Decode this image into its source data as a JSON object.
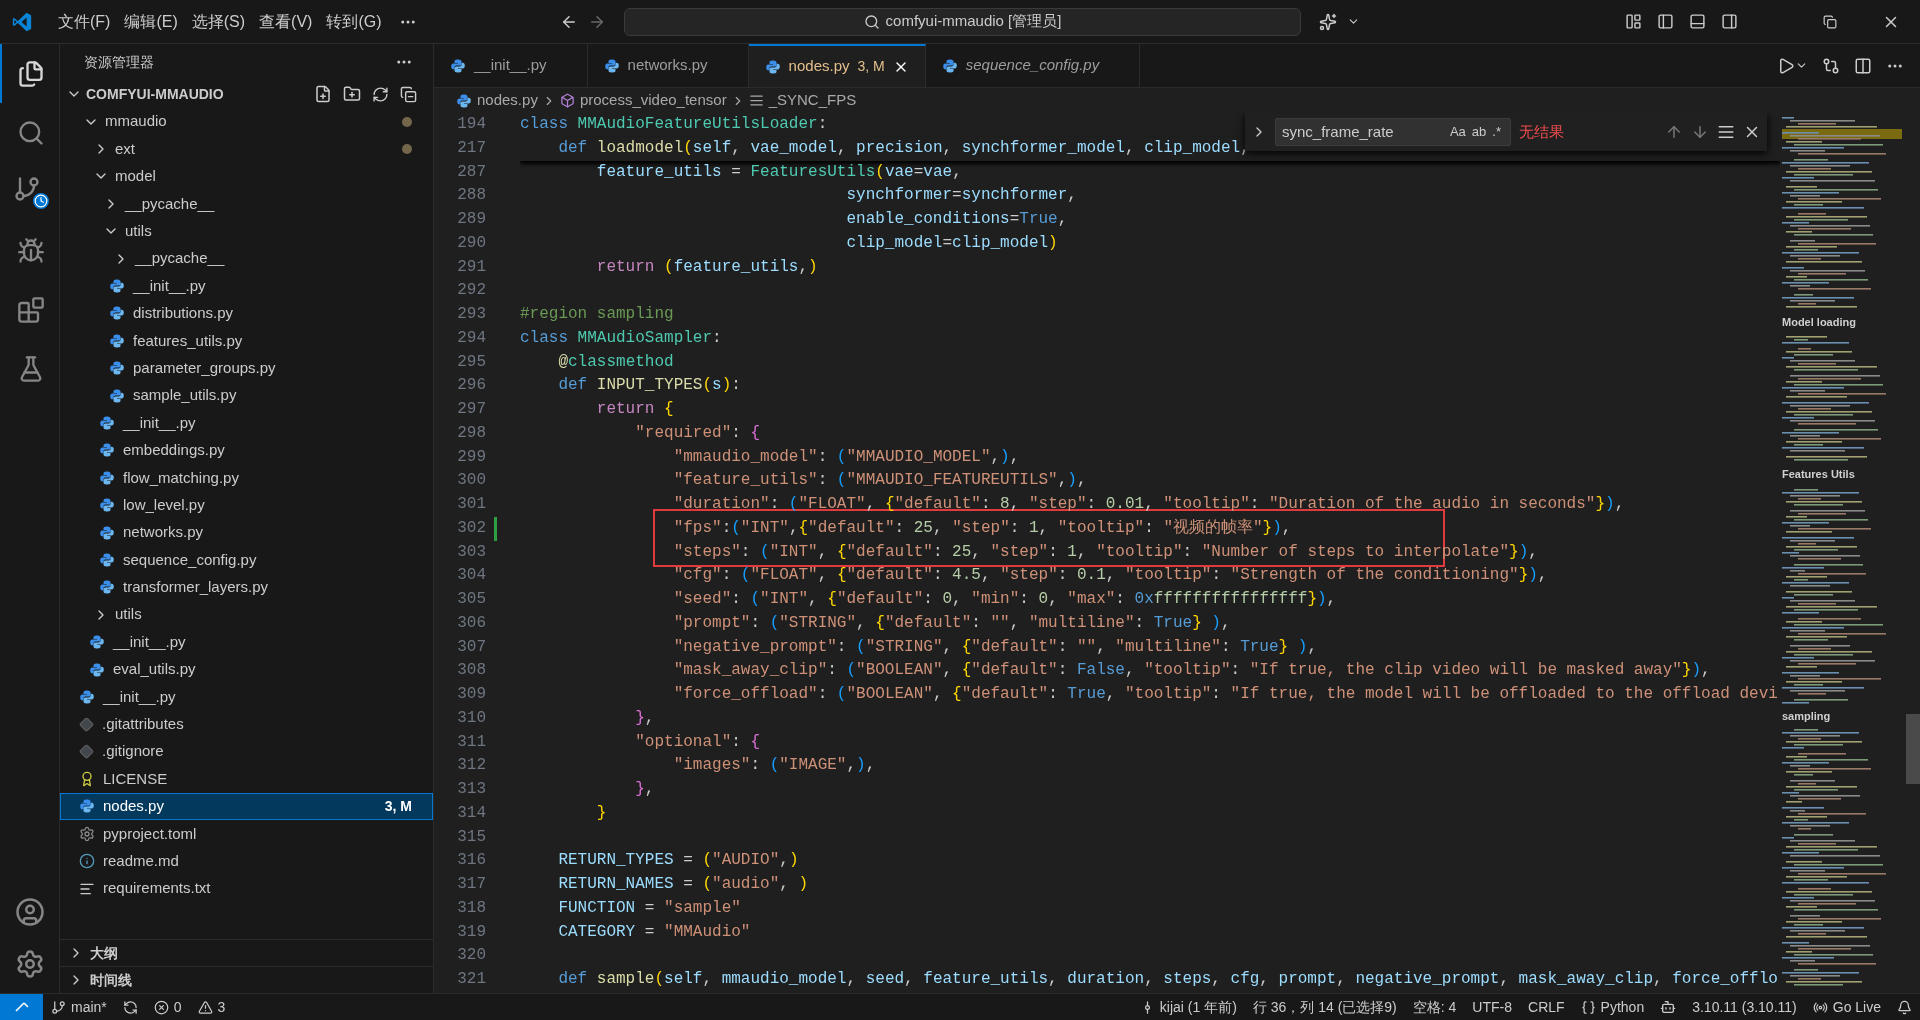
{
  "title_bar": {
    "menus": [
      "文件(F)",
      "编辑(E)",
      "选择(S)",
      "查看(V)",
      "转到(G)"
    ],
    "command_center": "comfyui-mmaudio [管理员]"
  },
  "activity_bar": [
    {
      "kind": "explorer",
      "selected": true
    },
    {
      "kind": "search",
      "selected": false
    },
    {
      "kind": "source-control",
      "selected": false
    },
    {
      "kind": "debug",
      "selected": false
    },
    {
      "kind": "extensions",
      "selected": false
    },
    {
      "kind": "testing",
      "selected": false
    }
  ],
  "sidebar": {
    "title": "资源管理器",
    "root": "COMFYUI-MMAUDIO",
    "tree": [
      {
        "label": "mmaudio",
        "kind": "folder",
        "expanded": true,
        "selected": false,
        "modified": true,
        "children": [
          {
            "label": "ext",
            "kind": "folder",
            "expanded": false,
            "selected": false,
            "modified": true
          },
          {
            "label": "model",
            "kind": "folder",
            "expanded": true,
            "selected": false,
            "modified": false,
            "children": [
              {
                "label": "__pycache__",
                "kind": "folder",
                "expanded": false,
                "selected": false,
                "modified": false
              },
              {
                "label": "utils",
                "kind": "folder",
                "expanded": true,
                "selected": false,
                "modified": false,
                "children": [
                  {
                    "label": "__pycache__",
                    "kind": "folder",
                    "expanded": false,
                    "selected": false,
                    "modified": false
                  },
                  {
                    "label": "__init__.py",
                    "kind": "python",
                    "selected": false,
                    "modified": false
                  },
                  {
                    "label": "distributions.py",
                    "kind": "python",
                    "selected": false,
                    "modified": false
                  },
                  {
                    "label": "features_utils.py",
                    "kind": "python",
                    "selected": false,
                    "modified": false
                  },
                  {
                    "label": "parameter_groups.py",
                    "kind": "python",
                    "selected": false,
                    "modified": false
                  },
                  {
                    "label": "sample_utils.py",
                    "kind": "python",
                    "selected": false,
                    "modified": false
                  }
                ]
              },
              {
                "label": "__init__.py",
                "kind": "python",
                "selected": false,
                "modified": false
              },
              {
                "label": "embeddings.py",
                "kind": "python",
                "selected": false,
                "modified": false
              },
              {
                "label": "flow_matching.py",
                "kind": "python",
                "selected": false,
                "modified": false
              },
              {
                "label": "low_level.py",
                "kind": "python",
                "selected": false,
                "modified": false
              },
              {
                "label": "networks.py",
                "kind": "python",
                "selected": false,
                "modified": false
              },
              {
                "label": "sequence_config.py",
                "kind": "python",
                "selected": false,
                "modified": false
              },
              {
                "label": "transformer_layers.py",
                "kind": "python",
                "selected": false,
                "modified": false
              }
            ]
          },
          {
            "label": "utils",
            "kind": "folder",
            "expanded": false,
            "selected": false,
            "modified": false
          },
          {
            "label": "__init__.py",
            "kind": "python",
            "selected": false,
            "modified": false
          },
          {
            "label": "eval_utils.py",
            "kind": "python",
            "selected": false,
            "modified": false
          }
        ]
      },
      {
        "label": "__init__.py",
        "kind": "python",
        "selected": false,
        "modified": false
      },
      {
        "label": ".gitattributes",
        "kind": "git",
        "selected": false,
        "modified": false
      },
      {
        "label": ".gitignore",
        "kind": "git",
        "selected": false,
        "modified": false
      },
      {
        "label": "LICENSE",
        "kind": "license",
        "selected": false,
        "modified": false
      },
      {
        "label": "nodes.py",
        "kind": "python",
        "selected": true,
        "modified": false,
        "badge": "3, M"
      },
      {
        "label": "pyproject.toml",
        "kind": "config",
        "selected": false,
        "modified": false
      },
      {
        "label": "readme.md",
        "kind": "info",
        "selected": false,
        "modified": false
      },
      {
        "label": "requirements.txt",
        "kind": "text",
        "selected": false,
        "modified": false
      }
    ],
    "panels": [
      {
        "label": "大纲",
        "expanded": false
      },
      {
        "label": "时间线",
        "expanded": false
      }
    ]
  },
  "tabs": [
    {
      "label": "__init__.py",
      "selected": false,
      "preview": false
    },
    {
      "label": "networks.py",
      "selected": false,
      "preview": false
    },
    {
      "label": "nodes.py",
      "selected": true,
      "preview": false,
      "badge": "3, M"
    },
    {
      "label": "sequence_config.py",
      "selected": false,
      "preview": true
    }
  ],
  "breadcrumb": [
    {
      "kind": "file",
      "label": "nodes.py"
    },
    {
      "kind": "function",
      "label": "process_video_tensor"
    },
    {
      "kind": "constant",
      "label": "_SYNC_FPS"
    }
  ],
  "find": {
    "query": "sync_frame_rate",
    "result": "无结果",
    "options": [
      {
        "label": "Aa",
        "on": false
      },
      {
        "label": "ab",
        "on": false
      },
      {
        "label": ".*",
        "on": false
      }
    ]
  },
  "code": [
    {
      "num": "194",
      "modified": false,
      "tokens": [
        {
          "kind": "k",
          "text": "class "
        },
        {
          "kind": "t",
          "text": "MMAudioFeatureUtilsLoader"
        },
        {
          "kind": "p",
          "text": ":"
        }
      ]
    },
    {
      "num": "217",
      "modified": false,
      "tokens": [
        {
          "kind": "k",
          "text": "    def "
        },
        {
          "kind": "f",
          "text": "loadmodel"
        },
        {
          "kind": "b1",
          "text": "("
        },
        {
          "kind": "v",
          "text": "self"
        },
        {
          "kind": "p",
          "text": ", "
        },
        {
          "kind": "v",
          "text": "vae_model"
        },
        {
          "kind": "p",
          "text": ", "
        },
        {
          "kind": "v",
          "text": "precision"
        },
        {
          "kind": "p",
          "text": ", "
        },
        {
          "kind": "v",
          "text": "synchformer_model"
        },
        {
          "kind": "p",
          "text": ", "
        },
        {
          "kind": "v",
          "text": "clip_model"
        },
        {
          "kind": "p",
          "text": ","
        }
      ]
    },
    {
      "num": "287",
      "modified": false,
      "tokens": [
        {
          "kind": "v",
          "text": "        feature_utils"
        },
        {
          "kind": "p",
          "text": " = "
        },
        {
          "kind": "t",
          "text": "FeaturesUtils"
        },
        {
          "kind": "b1",
          "text": "("
        },
        {
          "kind": "v",
          "text": "vae"
        },
        {
          "kind": "p",
          "text": "="
        },
        {
          "kind": "v",
          "text": "vae"
        },
        {
          "kind": "p",
          "text": ","
        }
      ]
    },
    {
      "num": "288",
      "modified": false,
      "tokens": [
        {
          "kind": "v",
          "text": "                                  synchformer"
        },
        {
          "kind": "p",
          "text": "="
        },
        {
          "kind": "v",
          "text": "synchformer"
        },
        {
          "kind": "p",
          "text": ","
        }
      ]
    },
    {
      "num": "289",
      "modified": false,
      "tokens": [
        {
          "kind": "v",
          "text": "                                  enable_conditions"
        },
        {
          "kind": "p",
          "text": "="
        },
        {
          "kind": "k",
          "text": "True"
        },
        {
          "kind": "p",
          "text": ","
        }
      ]
    },
    {
      "num": "290",
      "modified": false,
      "tokens": [
        {
          "kind": "v",
          "text": "                                  clip_model"
        },
        {
          "kind": "p",
          "text": "="
        },
        {
          "kind": "v",
          "text": "clip_model"
        },
        {
          "kind": "b1",
          "text": ")"
        }
      ]
    },
    {
      "num": "291",
      "modified": false,
      "tokens": [
        {
          "kind": "c",
          "text": "        return "
        },
        {
          "kind": "b1",
          "text": "("
        },
        {
          "kind": "v",
          "text": "feature_utils"
        },
        {
          "kind": "p",
          "text": ","
        },
        {
          "kind": "b1",
          "text": ")"
        }
      ]
    },
    {
      "num": "292",
      "modified": false
    },
    {
      "num": "293",
      "modified": false,
      "tokens": [
        {
          "kind": "m",
          "text": "#region sampling"
        }
      ]
    },
    {
      "num": "294",
      "modified": false,
      "tokens": [
        {
          "kind": "k",
          "text": "class "
        },
        {
          "kind": "t",
          "text": "MMAudioSampler"
        },
        {
          "kind": "p",
          "text": ":"
        }
      ]
    },
    {
      "num": "295",
      "modified": false,
      "tokens": [
        {
          "kind": "f",
          "text": "    @"
        },
        {
          "kind": "t",
          "text": "classmethod"
        }
      ]
    },
    {
      "num": "296",
      "modified": false,
      "tokens": [
        {
          "kind": "k",
          "text": "    def "
        },
        {
          "kind": "f",
          "text": "INPUT_TYPES"
        },
        {
          "kind": "b1",
          "text": "("
        },
        {
          "kind": "v",
          "text": "s"
        },
        {
          "kind": "b1",
          "text": ")"
        },
        {
          "kind": "p",
          "text": ":"
        }
      ]
    },
    {
      "num": "297",
      "modified": false,
      "tokens": [
        {
          "kind": "c",
          "text": "        return "
        },
        {
          "kind": "b1",
          "text": "{"
        }
      ]
    },
    {
      "num": "298",
      "modified": false,
      "tokens": [
        {
          "kind": "s",
          "text": "            \"required\""
        },
        {
          "kind": "p",
          "text": ": "
        },
        {
          "kind": "b2",
          "text": "{"
        }
      ]
    },
    {
      "num": "299",
      "modified": false,
      "tokens": [
        {
          "kind": "s",
          "text": "                \"mmaudio_model\""
        },
        {
          "kind": "p",
          "text": ": "
        },
        {
          "kind": "b3",
          "text": "("
        },
        {
          "kind": "s",
          "text": "\"MMAUDIO_MODEL\""
        },
        {
          "kind": "p",
          "text": ","
        },
        {
          "kind": "b3",
          "text": ")"
        },
        {
          "kind": "p",
          "text": ","
        }
      ]
    },
    {
      "num": "300",
      "modified": false,
      "tokens": [
        {
          "kind": "s",
          "text": "                \"feature_utils\""
        },
        {
          "kind": "p",
          "text": ": "
        },
        {
          "kind": "b3",
          "text": "("
        },
        {
          "kind": "s",
          "text": "\"MMAUDIO_FEATUREUTILS\""
        },
        {
          "kind": "p",
          "text": ","
        },
        {
          "kind": "b3",
          "text": ")"
        },
        {
          "kind": "p",
          "text": ","
        }
      ]
    },
    {
      "num": "301",
      "modified": false,
      "tokens": [
        {
          "kind": "s",
          "text": "                \"duration\""
        },
        {
          "kind": "p",
          "text": ": "
        },
        {
          "kind": "b3",
          "text": "("
        },
        {
          "kind": "s",
          "text": "\"FLOAT\""
        },
        {
          "kind": "p",
          "text": ", "
        },
        {
          "kind": "b1",
          "text": "{"
        },
        {
          "kind": "s",
          "text": "\"default\""
        },
        {
          "kind": "p",
          "text": ": "
        },
        {
          "kind": "n",
          "text": "8"
        },
        {
          "kind": "p",
          "text": ", "
        },
        {
          "kind": "s",
          "text": "\"step\""
        },
        {
          "kind": "p",
          "text": ": "
        },
        {
          "kind": "n",
          "text": "0.01"
        },
        {
          "kind": "p",
          "text": ", "
        },
        {
          "kind": "s",
          "text": "\"tooltip\""
        },
        {
          "kind": "p",
          "text": ": "
        },
        {
          "kind": "s",
          "text": "\"Duration of the audio in seconds\""
        },
        {
          "kind": "b1",
          "text": "}"
        },
        {
          "kind": "b3",
          "text": ")"
        },
        {
          "kind": "p",
          "text": ","
        }
      ]
    },
    {
      "num": "302",
      "modified": true,
      "tokens": [
        {
          "kind": "s",
          "text": "                \"fps\""
        },
        {
          "kind": "p",
          "text": ":"
        },
        {
          "kind": "b3",
          "text": "("
        },
        {
          "kind": "s",
          "text": "\"INT\""
        },
        {
          "kind": "p",
          "text": ","
        },
        {
          "kind": "b1",
          "text": "{"
        },
        {
          "kind": "s",
          "text": "\"default\""
        },
        {
          "kind": "p",
          "text": ": "
        },
        {
          "kind": "n",
          "text": "25"
        },
        {
          "kind": "p",
          "text": ", "
        },
        {
          "kind": "s",
          "text": "\"step\""
        },
        {
          "kind": "p",
          "text": ": "
        },
        {
          "kind": "n",
          "text": "1"
        },
        {
          "kind": "p",
          "text": ", "
        },
        {
          "kind": "s",
          "text": "\"tooltip\""
        },
        {
          "kind": "p",
          "text": ": "
        },
        {
          "kind": "s",
          "text": "\"视频的帧率\""
        },
        {
          "kind": "b1",
          "text": "}"
        },
        {
          "kind": "b3",
          "text": ")"
        },
        {
          "kind": "p",
          "text": ","
        }
      ]
    },
    {
      "num": "303",
      "modified": false,
      "tokens": [
        {
          "kind": "s",
          "text": "                \"steps\""
        },
        {
          "kind": "p",
          "text": ": "
        },
        {
          "kind": "b3",
          "text": "("
        },
        {
          "kind": "s",
          "text": "\"INT\""
        },
        {
          "kind": "p",
          "text": ", "
        },
        {
          "kind": "b1",
          "text": "{"
        },
        {
          "kind": "s",
          "text": "\"default\""
        },
        {
          "kind": "p",
          "text": ": "
        },
        {
          "kind": "n",
          "text": "25"
        },
        {
          "kind": "p",
          "text": ", "
        },
        {
          "kind": "s",
          "text": "\"step\""
        },
        {
          "kind": "p",
          "text": ": "
        },
        {
          "kind": "n",
          "text": "1"
        },
        {
          "kind": "p",
          "text": ", "
        },
        {
          "kind": "s",
          "text": "\"tooltip\""
        },
        {
          "kind": "p",
          "text": ": "
        },
        {
          "kind": "s",
          "text": "\"Number of steps to interpolate\""
        },
        {
          "kind": "b1",
          "text": "}"
        },
        {
          "kind": "b3",
          "text": ")"
        },
        {
          "kind": "p",
          "text": ","
        }
      ]
    },
    {
      "num": "304",
      "modified": false,
      "tokens": [
        {
          "kind": "s",
          "text": "                \"cfg\""
        },
        {
          "kind": "p",
          "text": ": "
        },
        {
          "kind": "b3",
          "text": "("
        },
        {
          "kind": "s",
          "text": "\"FLOAT\""
        },
        {
          "kind": "p",
          "text": ", "
        },
        {
          "kind": "b1",
          "text": "{"
        },
        {
          "kind": "s",
          "text": "\"default\""
        },
        {
          "kind": "p",
          "text": ": "
        },
        {
          "kind": "n",
          "text": "4.5"
        },
        {
          "kind": "p",
          "text": ", "
        },
        {
          "kind": "s",
          "text": "\"step\""
        },
        {
          "kind": "p",
          "text": ": "
        },
        {
          "kind": "n",
          "text": "0.1"
        },
        {
          "kind": "p",
          "text": ", "
        },
        {
          "kind": "s",
          "text": "\"tooltip\""
        },
        {
          "kind": "p",
          "text": ": "
        },
        {
          "kind": "s",
          "text": "\"Strength of the conditioning\""
        },
        {
          "kind": "b1",
          "text": "}"
        },
        {
          "kind": "b3",
          "text": ")"
        },
        {
          "kind": "p",
          "text": ","
        }
      ]
    },
    {
      "num": "305",
      "modified": false,
      "tokens": [
        {
          "kind": "s",
          "text": "                \"seed\""
        },
        {
          "kind": "p",
          "text": ": "
        },
        {
          "kind": "b3",
          "text": "("
        },
        {
          "kind": "s",
          "text": "\"INT\""
        },
        {
          "kind": "p",
          "text": ", "
        },
        {
          "kind": "b1",
          "text": "{"
        },
        {
          "kind": "s",
          "text": "\"default\""
        },
        {
          "kind": "p",
          "text": ": "
        },
        {
          "kind": "n",
          "text": "0"
        },
        {
          "kind": "p",
          "text": ", "
        },
        {
          "kind": "s",
          "text": "\"min\""
        },
        {
          "kind": "p",
          "text": ": "
        },
        {
          "kind": "n",
          "text": "0"
        },
        {
          "kind": "p",
          "text": ", "
        },
        {
          "kind": "s",
          "text": "\"max\""
        },
        {
          "kind": "p",
          "text": ": "
        },
        {
          "kind": "k",
          "text": "0x"
        },
        {
          "kind": "n",
          "text": "ffffffffffffffff"
        },
        {
          "kind": "b1",
          "text": "}"
        },
        {
          "kind": "b3",
          "text": ")"
        },
        {
          "kind": "p",
          "text": ","
        }
      ]
    },
    {
      "num": "306",
      "modified": false,
      "tokens": [
        {
          "kind": "s",
          "text": "                \"prompt\""
        },
        {
          "kind": "p",
          "text": ": "
        },
        {
          "kind": "b3",
          "text": "("
        },
        {
          "kind": "s",
          "text": "\"STRING\""
        },
        {
          "kind": "p",
          "text": ", "
        },
        {
          "kind": "b1",
          "text": "{"
        },
        {
          "kind": "s",
          "text": "\"default\""
        },
        {
          "kind": "p",
          "text": ": "
        },
        {
          "kind": "s",
          "text": "\"\""
        },
        {
          "kind": "p",
          "text": ", "
        },
        {
          "kind": "s",
          "text": "\"multiline\""
        },
        {
          "kind": "p",
          "text": ": "
        },
        {
          "kind": "k",
          "text": "True"
        },
        {
          "kind": "b1",
          "text": "}"
        },
        {
          "kind": "b3",
          "text": " )"
        },
        {
          "kind": "p",
          "text": ","
        }
      ]
    },
    {
      "num": "307",
      "modified": false,
      "tokens": [
        {
          "kind": "s",
          "text": "                \"negative_prompt\""
        },
        {
          "kind": "p",
          "text": ": "
        },
        {
          "kind": "b3",
          "text": "("
        },
        {
          "kind": "s",
          "text": "\"STRING\""
        },
        {
          "kind": "p",
          "text": ", "
        },
        {
          "kind": "b1",
          "text": "{"
        },
        {
          "kind": "s",
          "text": "\"default\""
        },
        {
          "kind": "p",
          "text": ": "
        },
        {
          "kind": "s",
          "text": "\"\""
        },
        {
          "kind": "p",
          "text": ", "
        },
        {
          "kind": "s",
          "text": "\"multiline\""
        },
        {
          "kind": "p",
          "text": ": "
        },
        {
          "kind": "k",
          "text": "True"
        },
        {
          "kind": "b1",
          "text": "}"
        },
        {
          "kind": "b3",
          "text": " )"
        },
        {
          "kind": "p",
          "text": ","
        }
      ]
    },
    {
      "num": "308",
      "modified": false,
      "tokens": [
        {
          "kind": "s",
          "text": "                \"mask_away_clip\""
        },
        {
          "kind": "p",
          "text": ": "
        },
        {
          "kind": "b3",
          "text": "("
        },
        {
          "kind": "s",
          "text": "\"BOOLEAN\""
        },
        {
          "kind": "p",
          "text": ", "
        },
        {
          "kind": "b1",
          "text": "{"
        },
        {
          "kind": "s",
          "text": "\"default\""
        },
        {
          "kind": "p",
          "text": ": "
        },
        {
          "kind": "k",
          "text": "False"
        },
        {
          "kind": "p",
          "text": ", "
        },
        {
          "kind": "s",
          "text": "\"tooltip\""
        },
        {
          "kind": "p",
          "text": ": "
        },
        {
          "kind": "s",
          "text": "\"If true, the clip video will be masked away\""
        },
        {
          "kind": "b1",
          "text": "}"
        },
        {
          "kind": "b3",
          "text": ")"
        },
        {
          "kind": "p",
          "text": ","
        }
      ]
    },
    {
      "num": "309",
      "modified": false,
      "tokens": [
        {
          "kind": "s",
          "text": "                \"force_offload\""
        },
        {
          "kind": "p",
          "text": ": "
        },
        {
          "kind": "b3",
          "text": "("
        },
        {
          "kind": "s",
          "text": "\"BOOLEAN\""
        },
        {
          "kind": "p",
          "text": ", "
        },
        {
          "kind": "b1",
          "text": "{"
        },
        {
          "kind": "s",
          "text": "\"default\""
        },
        {
          "kind": "p",
          "text": ": "
        },
        {
          "kind": "k",
          "text": "True"
        },
        {
          "kind": "p",
          "text": ", "
        },
        {
          "kind": "s",
          "text": "\"tooltip\""
        },
        {
          "kind": "p",
          "text": ": "
        },
        {
          "kind": "s",
          "text": "\"If true, the model will be offloaded to the offload devi"
        }
      ]
    },
    {
      "num": "310",
      "modified": false,
      "tokens": [
        {
          "kind": "b2",
          "text": "            }"
        },
        {
          "kind": "p",
          "text": ","
        }
      ]
    },
    {
      "num": "311",
      "modified": false,
      "tokens": [
        {
          "kind": "s",
          "text": "            \"optional\""
        },
        {
          "kind": "p",
          "text": ": "
        },
        {
          "kind": "b2",
          "text": "{"
        }
      ]
    },
    {
      "num": "312",
      "modified": false,
      "tokens": [
        {
          "kind": "s",
          "text": "                \"images\""
        },
        {
          "kind": "p",
          "text": ": "
        },
        {
          "kind": "b3",
          "text": "("
        },
        {
          "kind": "s",
          "text": "\"IMAGE\""
        },
        {
          "kind": "p",
          "text": ","
        },
        {
          "kind": "b3",
          "text": ")"
        },
        {
          "kind": "p",
          "text": ","
        }
      ]
    },
    {
      "num": "313",
      "modified": false,
      "tokens": [
        {
          "kind": "b2",
          "text": "            }"
        },
        {
          "kind": "p",
          "text": ","
        }
      ]
    },
    {
      "num": "314",
      "modified": false,
      "tokens": [
        {
          "kind": "b1",
          "text": "        }"
        }
      ]
    },
    {
      "num": "315",
      "modified": false
    },
    {
      "num": "316",
      "modified": false,
      "tokens": [
        {
          "kind": "v",
          "text": "    RETURN_TYPES"
        },
        {
          "kind": "p",
          "text": " = "
        },
        {
          "kind": "b1",
          "text": "("
        },
        {
          "kind": "s",
          "text": "\"AUDIO\""
        },
        {
          "kind": "p",
          "text": ","
        },
        {
          "kind": "b1",
          "text": ")"
        }
      ]
    },
    {
      "num": "317",
      "modified": false,
      "tokens": [
        {
          "kind": "v",
          "text": "    RETURN_NAMES"
        },
        {
          "kind": "p",
          "text": " = "
        },
        {
          "kind": "b1",
          "text": "("
        },
        {
          "kind": "s",
          "text": "\"audio\""
        },
        {
          "kind": "p",
          "text": ", "
        },
        {
          "kind": "b1",
          "text": ")"
        }
      ]
    },
    {
      "num": "318",
      "modified": false,
      "tokens": [
        {
          "kind": "v",
          "text": "    FUNCTION"
        },
        {
          "kind": "p",
          "text": " = "
        },
        {
          "kind": "s",
          "text": "\"sample\""
        }
      ]
    },
    {
      "num": "319",
      "modified": false,
      "tokens": [
        {
          "kind": "v",
          "text": "    CATEGORY"
        },
        {
          "kind": "p",
          "text": " = "
        },
        {
          "kind": "s",
          "text": "\"MMAudio\""
        }
      ]
    },
    {
      "num": "320",
      "modified": false
    },
    {
      "num": "321",
      "modified": false,
      "tokens": [
        {
          "kind": "k",
          "text": "    def "
        },
        {
          "kind": "f",
          "text": "sample"
        },
        {
          "kind": "b1",
          "text": "("
        },
        {
          "kind": "v",
          "text": "self"
        },
        {
          "kind": "p",
          "text": ", "
        },
        {
          "kind": "v",
          "text": "mmaudio_model"
        },
        {
          "kind": "p",
          "text": ", "
        },
        {
          "kind": "v",
          "text": "seed"
        },
        {
          "kind": "p",
          "text": ", "
        },
        {
          "kind": "v",
          "text": "feature_utils"
        },
        {
          "kind": "p",
          "text": ", "
        },
        {
          "kind": "v",
          "text": "duration"
        },
        {
          "kind": "p",
          "text": ", "
        },
        {
          "kind": "v",
          "text": "steps"
        },
        {
          "kind": "p",
          "text": ", "
        },
        {
          "kind": "v",
          "text": "cfg"
        },
        {
          "kind": "p",
          "text": ", "
        },
        {
          "kind": "v",
          "text": "prompt"
        },
        {
          "kind": "p",
          "text": ", "
        },
        {
          "kind": "v",
          "text": "negative_prompt"
        },
        {
          "kind": "p",
          "text": ", "
        },
        {
          "kind": "v",
          "text": "mask_away_clip"
        },
        {
          "kind": "p",
          "text": ", "
        },
        {
          "kind": "v",
          "text": "force_offlo"
        }
      ]
    }
  ],
  "minimap": {
    "sections": [
      "Model loading",
      "Features Utils",
      "sampling"
    ]
  },
  "status_bar": {
    "left": [
      {
        "kind": "branch",
        "text": "main*"
      },
      {
        "kind": "sync"
      },
      {
        "kind": "errors",
        "text": "0"
      },
      {
        "kind": "warnings",
        "text": "3"
      }
    ],
    "right": [
      {
        "kind": "blame",
        "text": "kijai (1 年前)"
      },
      {
        "kind": "plain",
        "text": "行 36，列 14 (已选择9)"
      },
      {
        "kind": "plain",
        "text": "空格: 4"
      },
      {
        "kind": "plain",
        "text": "UTF-8"
      },
      {
        "kind": "plain",
        "text": "CRLF"
      },
      {
        "kind": "language",
        "text": "Python"
      },
      {
        "kind": "copilot"
      },
      {
        "kind": "plain",
        "text": "3.10.11 (3.10.11)"
      },
      {
        "kind": "live",
        "text": "Go Live"
      },
      {
        "kind": "bell"
      }
    ]
  }
}
